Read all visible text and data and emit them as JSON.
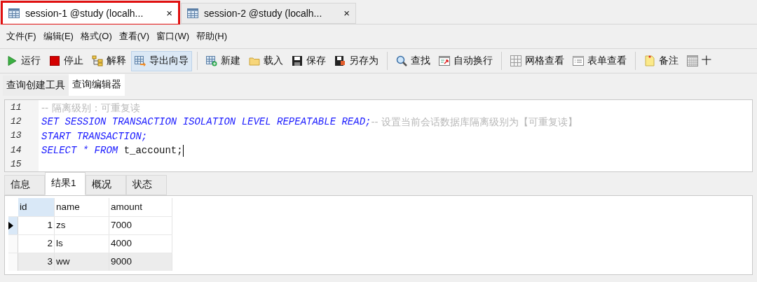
{
  "document_tabs": [
    {
      "label": "session-1 @study (localh...",
      "close": "×",
      "selected": true,
      "highlighted": true
    },
    {
      "label": "session-2 @study (localh...",
      "close": "×",
      "selected": false,
      "highlighted": false
    }
  ],
  "menu": [
    "文件(F)",
    "编辑(E)",
    "格式(O)",
    "查看(V)",
    "窗口(W)",
    "帮助(H)"
  ],
  "toolbar": [
    {
      "kind": "button",
      "label": "运行",
      "pressed": false
    },
    {
      "kind": "button",
      "label": "停止",
      "pressed": false
    },
    {
      "kind": "button",
      "label": "解释",
      "pressed": false
    },
    {
      "kind": "button",
      "label": "导出向导",
      "pressed": true
    },
    {
      "kind": "separator"
    },
    {
      "kind": "button",
      "label": "新建",
      "pressed": false
    },
    {
      "kind": "button",
      "label": "载入",
      "pressed": false
    },
    {
      "kind": "button",
      "label": "保存",
      "pressed": false
    },
    {
      "kind": "button",
      "label": "另存为",
      "pressed": false
    },
    {
      "kind": "separator"
    },
    {
      "kind": "button",
      "label": "查找",
      "pressed": false
    },
    {
      "kind": "button",
      "label": "自动换行",
      "pressed": false
    },
    {
      "kind": "separator"
    },
    {
      "kind": "button",
      "label": "网格查看",
      "pressed": false
    },
    {
      "kind": "button",
      "label": "表单查看",
      "pressed": false
    },
    {
      "kind": "separator"
    },
    {
      "kind": "button",
      "label": "备注",
      "pressed": false
    },
    {
      "kind": "button",
      "label": "十",
      "pressed": false
    }
  ],
  "editor_tabs": [
    {
      "label": "查询创建工具",
      "selected": false
    },
    {
      "label": "查询编辑器",
      "selected": true
    }
  ],
  "code_lines": [
    {
      "number": "11",
      "segments": [
        {
          "kind": "comment",
          "text": "-- 隔离级别：可重复读"
        }
      ]
    },
    {
      "number": "12",
      "segments": [
        {
          "kind": "keyword",
          "text": "SET SESSION TRANSACTION ISOLATION LEVEL REPEATABLE READ;"
        },
        {
          "kind": "comment",
          "text": "-- 设置当前会话数据库隔离级别为【可重复读】"
        }
      ]
    },
    {
      "number": "13",
      "segments": [
        {
          "kind": "keyword",
          "text": "START TRANSACTION;"
        }
      ]
    },
    {
      "number": "14",
      "segments": [
        {
          "kind": "keyword",
          "text": "SELECT * FROM "
        },
        {
          "kind": "plain",
          "text": "t_account;"
        }
      ],
      "cursor": true
    },
    {
      "number": "15"
    }
  ],
  "result_tabs": [
    {
      "label": "信息",
      "selected": false
    },
    {
      "label": "结果1",
      "selected": true
    },
    {
      "label": "概况",
      "selected": false
    },
    {
      "label": "状态",
      "selected": false
    }
  ],
  "table": {
    "columns": [
      {
        "label": "id",
        "selected": true
      },
      {
        "label": "name",
        "selected": false
      },
      {
        "label": "amount",
        "selected": false
      }
    ],
    "rows": [
      {
        "cells": [
          "1",
          "zs",
          "7000"
        ],
        "current": true,
        "shaded": false
      },
      {
        "cells": [
          "2",
          "ls",
          "4000"
        ],
        "current": false,
        "shaded": false
      },
      {
        "cells": [
          "3",
          "ww",
          "9000"
        ],
        "current": false,
        "shaded": true
      }
    ]
  }
}
